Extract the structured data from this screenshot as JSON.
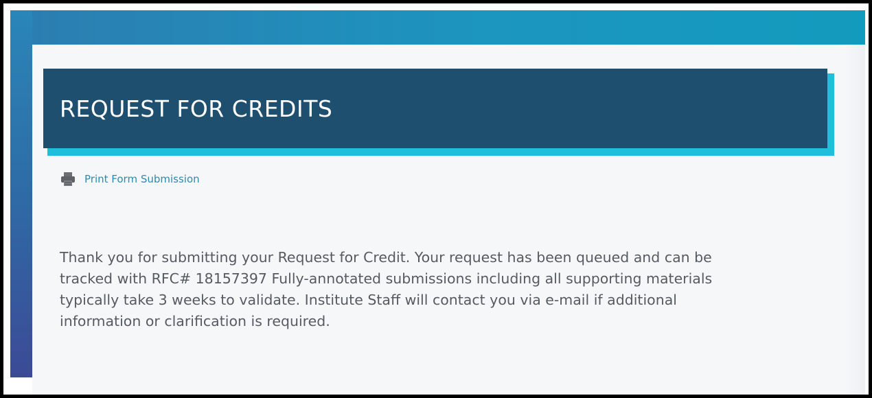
{
  "form": {
    "title": "REQUEST FOR CREDITS",
    "print_link_label": "Print Form Submission",
    "message_lines": [
      "Thank you for submitting your Request for Credit. Your request has been queued and can be",
      "tracked with RFC# 18157397 Fully-annotated submissions including all supporting materials",
      "typically take 3 weeks to validate. Institute Staff will contact you via e-mail if additional",
      "information or clarification is required."
    ]
  },
  "icons": {
    "print": "printer-icon"
  },
  "colors": {
    "header_bg": "#1e4f6f",
    "header_accent": "#1fbfdc",
    "top_band": "#1c95bf",
    "link": "#2a8bb0",
    "body_text": "#555b61"
  }
}
